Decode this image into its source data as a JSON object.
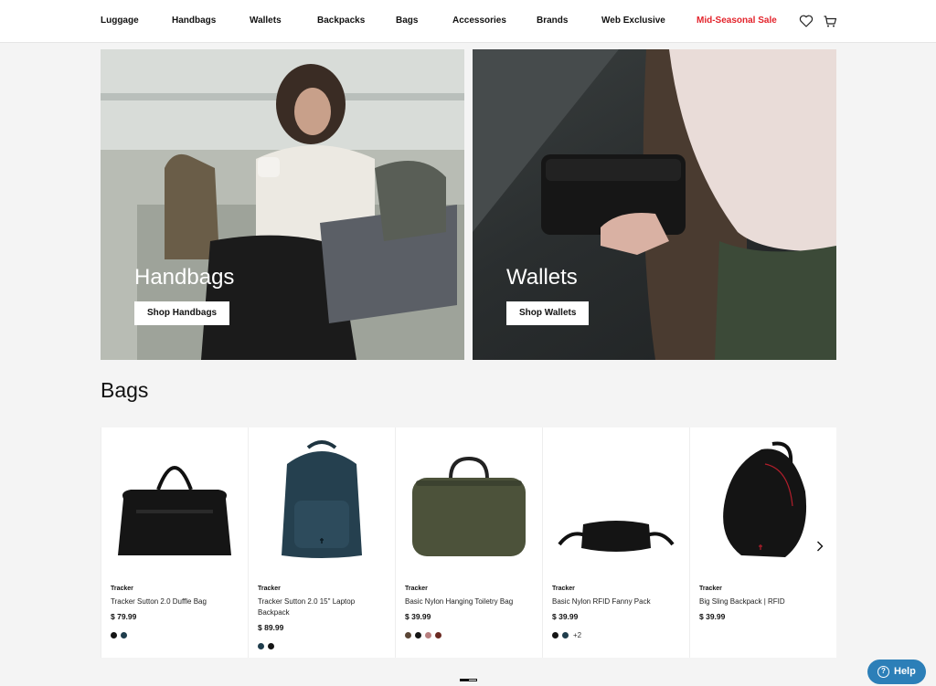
{
  "nav": {
    "items": [
      "Luggage",
      "Handbags",
      "Wallets",
      "Backpacks",
      "Bags",
      "Accessories",
      "Brands",
      "Web Exclusive",
      "Mid-Seasonal Sale"
    ],
    "icons": [
      "heart-icon",
      "cart-icon"
    ],
    "sale_color": "#e3232b"
  },
  "hero": [
    {
      "title": "Handbags",
      "button": "Shop Handbags"
    },
    {
      "title": "Wallets",
      "button": "Shop Wallets"
    }
  ],
  "section": {
    "title": "Bags"
  },
  "products": [
    {
      "brand": "Tracker",
      "name": "Tracker Sutton 2.0 Duffle Bag",
      "price": "$ 79.99",
      "swatches": [
        "#151515",
        "#1f3d4c"
      ],
      "more": ""
    },
    {
      "brand": "Tracker",
      "name": "Tracker Sutton 2.0 15\" Laptop Backpack",
      "price": "$ 89.99",
      "swatches": [
        "#1f3d4c",
        "#151515"
      ],
      "more": ""
    },
    {
      "brand": "Tracker",
      "name": "Basic Nylon Hanging Toiletry Bag",
      "price": "$ 39.99",
      "swatches": [
        "#5a4636",
        "#151515",
        "#b87f7f",
        "#6b2a22"
      ],
      "more": ""
    },
    {
      "brand": "Tracker",
      "name": "Basic Nylon RFID Fanny Pack",
      "price": "$ 39.99",
      "swatches": [
        "#151515",
        "#1f3d4c"
      ],
      "more": "+2"
    },
    {
      "brand": "Tracker",
      "name": "Big Sling Backpack | RFID",
      "price": "$ 39.99",
      "swatches": [],
      "more": ""
    }
  ],
  "carousel": {
    "next_icon": "chevron-right-icon",
    "page_indicator": "1"
  },
  "help": {
    "label": "Help",
    "icon": "question-icon",
    "color": "#2c7fb8"
  }
}
